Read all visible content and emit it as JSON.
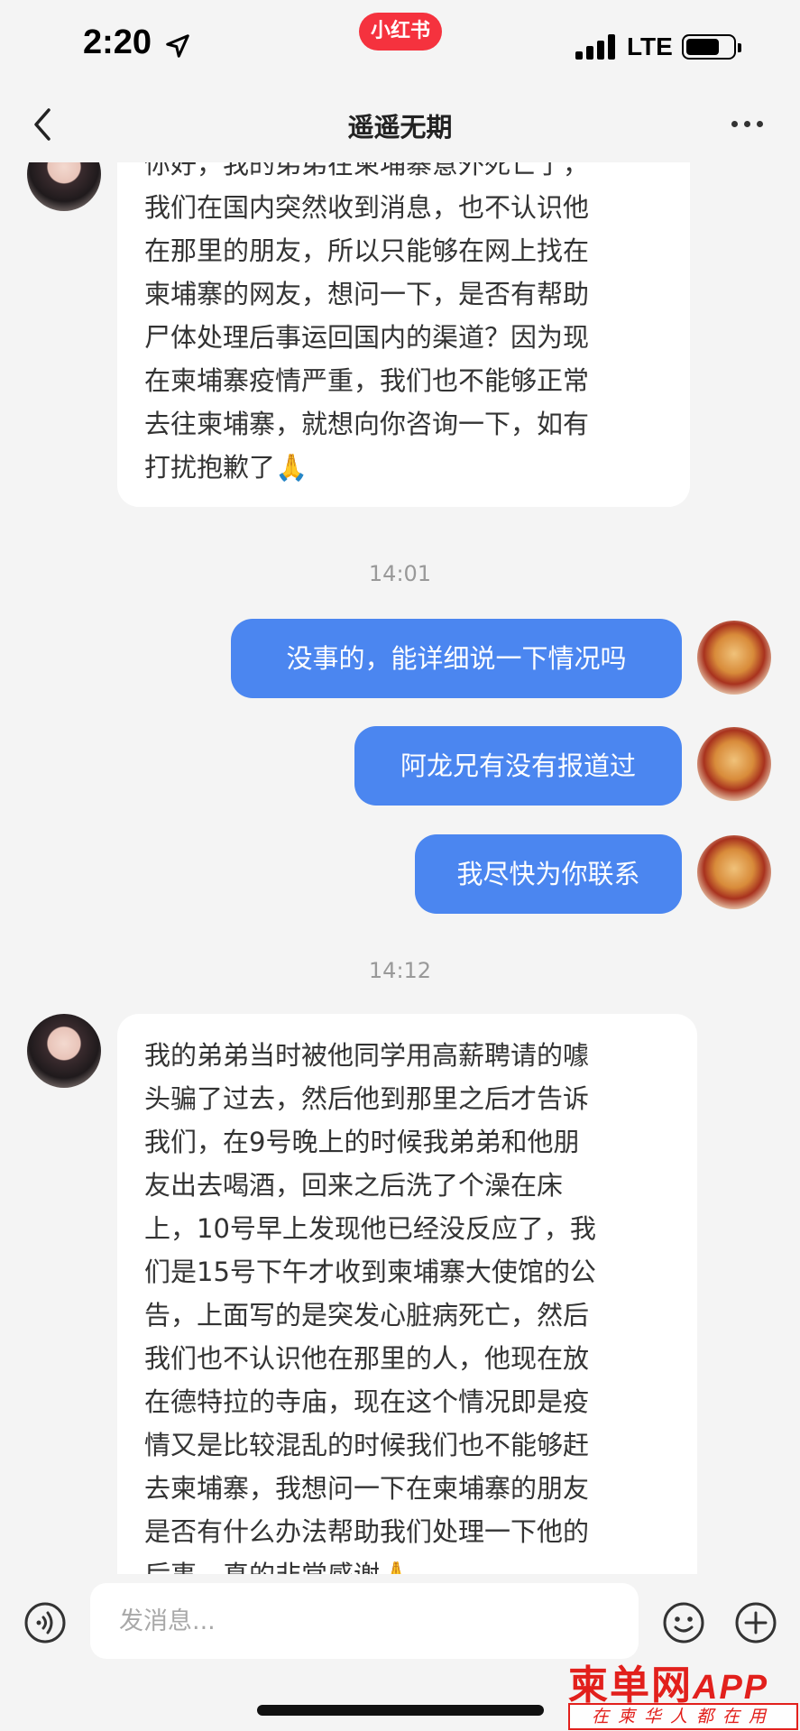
{
  "status_bar": {
    "time": "2:20",
    "network": "LTE",
    "app_badge": "小红书"
  },
  "header": {
    "title": "遥遥无期"
  },
  "messages": [
    {
      "direction": "in",
      "lines": [
        "你好，我的弟弟在柬埔寨意外死亡了，",
        "我们在国内突然收到消息，也不认识他",
        "在那里的朋友，所以只能够在网上找在",
        "柬埔寨的网友，想问一下，是否有帮助",
        "尸体处理后事运回国内的渠道？因为现",
        "在柬埔寨疫情严重，我们也不能够正常",
        "去往柬埔寨，就想向你咨询一下，如有",
        "打扰抱歉了🙏"
      ]
    },
    {
      "type": "timestamp",
      "text": "14:01"
    },
    {
      "direction": "out",
      "text": "没事的，能详细说一下情况吗"
    },
    {
      "direction": "out",
      "text": "阿龙兄有没有报道过"
    },
    {
      "direction": "out",
      "text": "我尽快为你联系"
    },
    {
      "type": "timestamp",
      "text": "14:12"
    },
    {
      "direction": "in",
      "lines": [
        "我的弟弟当时被他同学用高薪聘请的噱",
        "头骗了过去，然后他到那里之后才告诉",
        "我们，在9号晚上的时候我弟弟和他朋",
        "友出去喝酒，回来之后洗了个澡在床",
        "上，10号早上发现他已经没反应了，我",
        "们是15号下午才收到柬埔寨大使馆的公",
        "告，上面写的是突发心脏病死亡，然后",
        "我们也不认识他在那里的人，他现在放",
        "在德特拉的寺庙，现在这个情况即是疫",
        "情又是比较混乱的时候我们也不能够赶",
        "去柬埔寨，我想问一下在柬埔寨的朋友",
        "是否有什么办法帮助我们处理一下他的",
        "后事，真的非常感谢🙏"
      ]
    }
  ],
  "input": {
    "placeholder": "发消息..."
  },
  "watermark": {
    "main": "柬单网",
    "app": "APP",
    "slogan": "在柬华人都在用"
  },
  "colors": {
    "outgoing_bubble": "#4b86f0",
    "incoming_bubble": "#ffffff",
    "background": "#f4f4f4",
    "brand": "#f5323e"
  }
}
